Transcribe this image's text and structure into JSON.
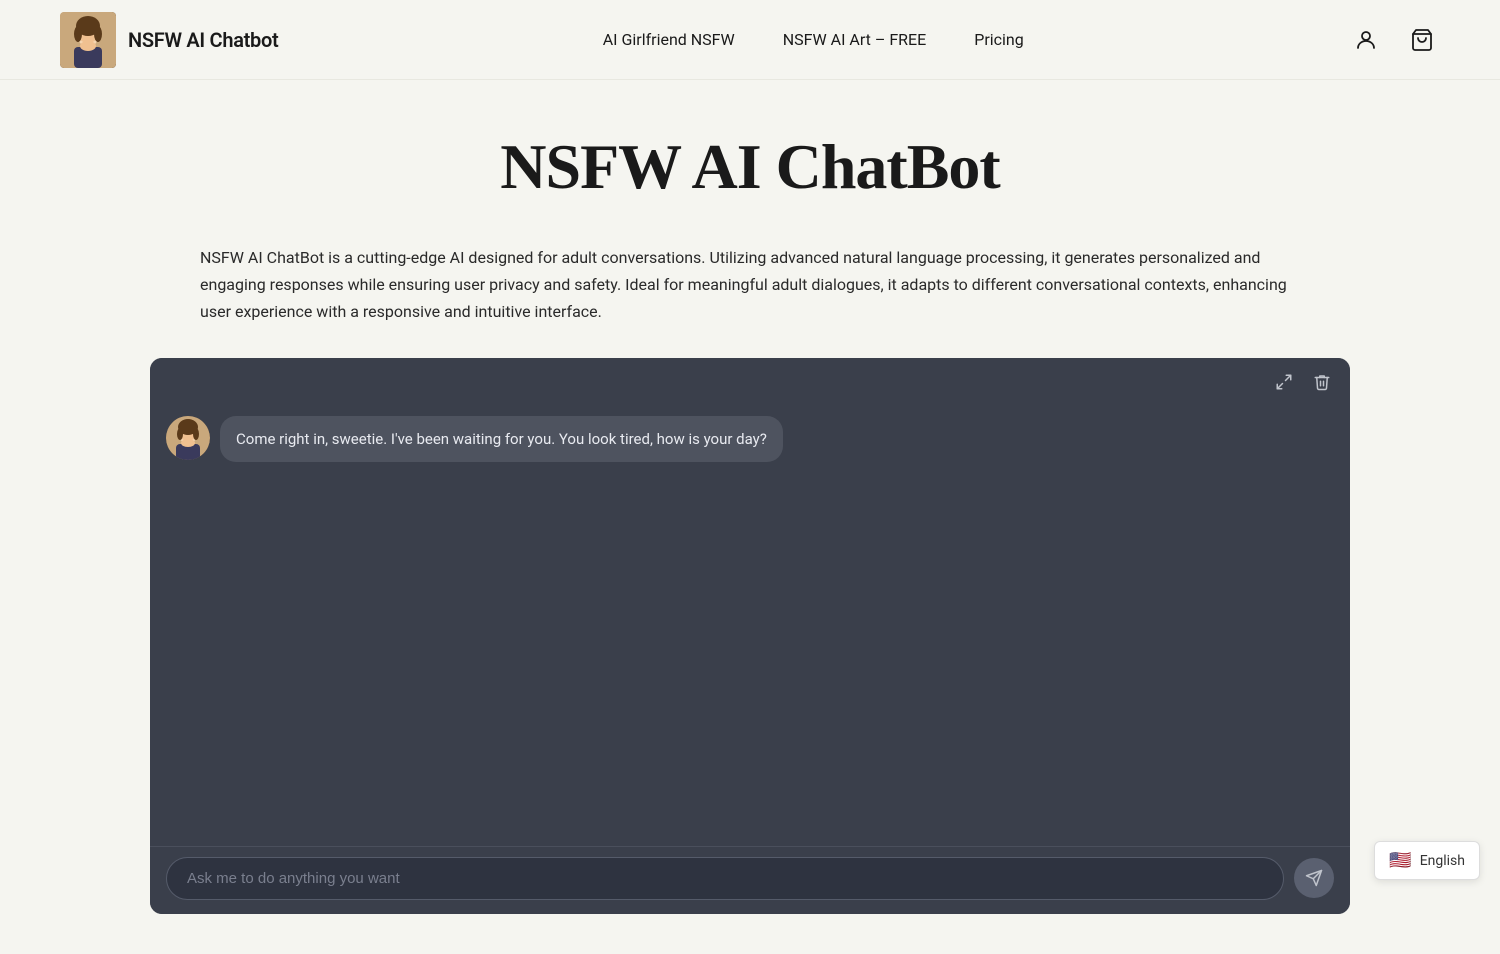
{
  "header": {
    "logo_text": "NSFW AI Chatbot",
    "logo_emoji": "👩",
    "nav": {
      "links": [
        {
          "label": "AI Girlfriend NSFW",
          "id": "ai-girlfriend"
        },
        {
          "label": "NSFW AI Art – FREE",
          "id": "nsfw-art"
        },
        {
          "label": "Pricing",
          "id": "pricing"
        }
      ]
    },
    "account_icon": "👤",
    "cart_icon": "🛒"
  },
  "main": {
    "title": "NSFW AI ChatBot",
    "description": "NSFW AI ChatBot is a cutting-edge AI designed for adult conversations. Utilizing advanced natural language processing, it generates personalized and engaging responses while ensuring user privacy and safety. Ideal for meaningful adult dialogues, it adapts to different conversational contexts, enhancing user experience with a responsive and intuitive interface."
  },
  "chat": {
    "toolbar": {
      "expand_label": "expand",
      "trash_label": "clear"
    },
    "messages": [
      {
        "sender": "bot",
        "avatar_emoji": "👩",
        "text": "Come right in, sweetie. I've been waiting for you. You look tired, how is your day?"
      }
    ],
    "input_placeholder": "Ask me to do anything you want"
  },
  "language_selector": {
    "flag": "🇺🇸",
    "label": "English"
  }
}
